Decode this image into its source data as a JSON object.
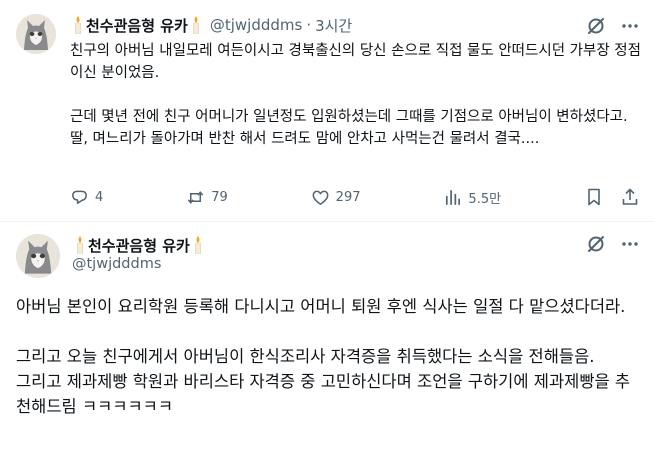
{
  "post1": {
    "display_name": "천수관음형 유카",
    "handle": "@tjwjdddms",
    "separator": "·",
    "time": "3시간",
    "paragraphs": [
      "친구의 아버님 내일모레 여든이시고 경북출신의 당신 손으로 직접 물도 안떠드시던 가부장 정점이신 분이었음.",
      "",
      "근데 몇년 전에 친구 어머니가 일년정도 입원하셨는데 그때를 기점으로 아버님이 변하셨다고.",
      "딸, 며느리가 돌아가며 반찬 해서 드려도 맘에 안차고 사먹는건 물려서 결국...."
    ],
    "actions": {
      "replies": "4",
      "reposts": "79",
      "likes": "297",
      "views": "5.5만"
    }
  },
  "post2": {
    "display_name": "천수관음형 유카",
    "handle": "@tjwjdddms",
    "paragraphs": [
      "아버님 본인이 요리학원 등록해 다니시고 어머니 퇴원 후엔 식사는 일절 다 맡으셨다더라.",
      "",
      "그리고 오늘 친구에게서 아버님이 한식조리사 자격증을 취득했다는 소식을 전해들음.",
      "그리고 제과제빵 학원과 바리스타 자격증 중  고민하신다며 조언을 구하기에 제과제빵을 추천해드림 ㅋㅋㅋㅋㅋㅋ"
    ]
  },
  "icons": {
    "avatar": "cat-avatar-icon",
    "candle": "candle-emoji-icon",
    "grok": "grok-icon",
    "more": "more-icon",
    "reply": "reply-icon",
    "repost": "repost-icon",
    "like": "heart-icon",
    "views": "views-icon",
    "bookmark": "bookmark-icon",
    "share": "share-icon"
  },
  "colors": {
    "text": "#0f1419",
    "secondary": "#536471",
    "divider": "#eff3f4"
  }
}
